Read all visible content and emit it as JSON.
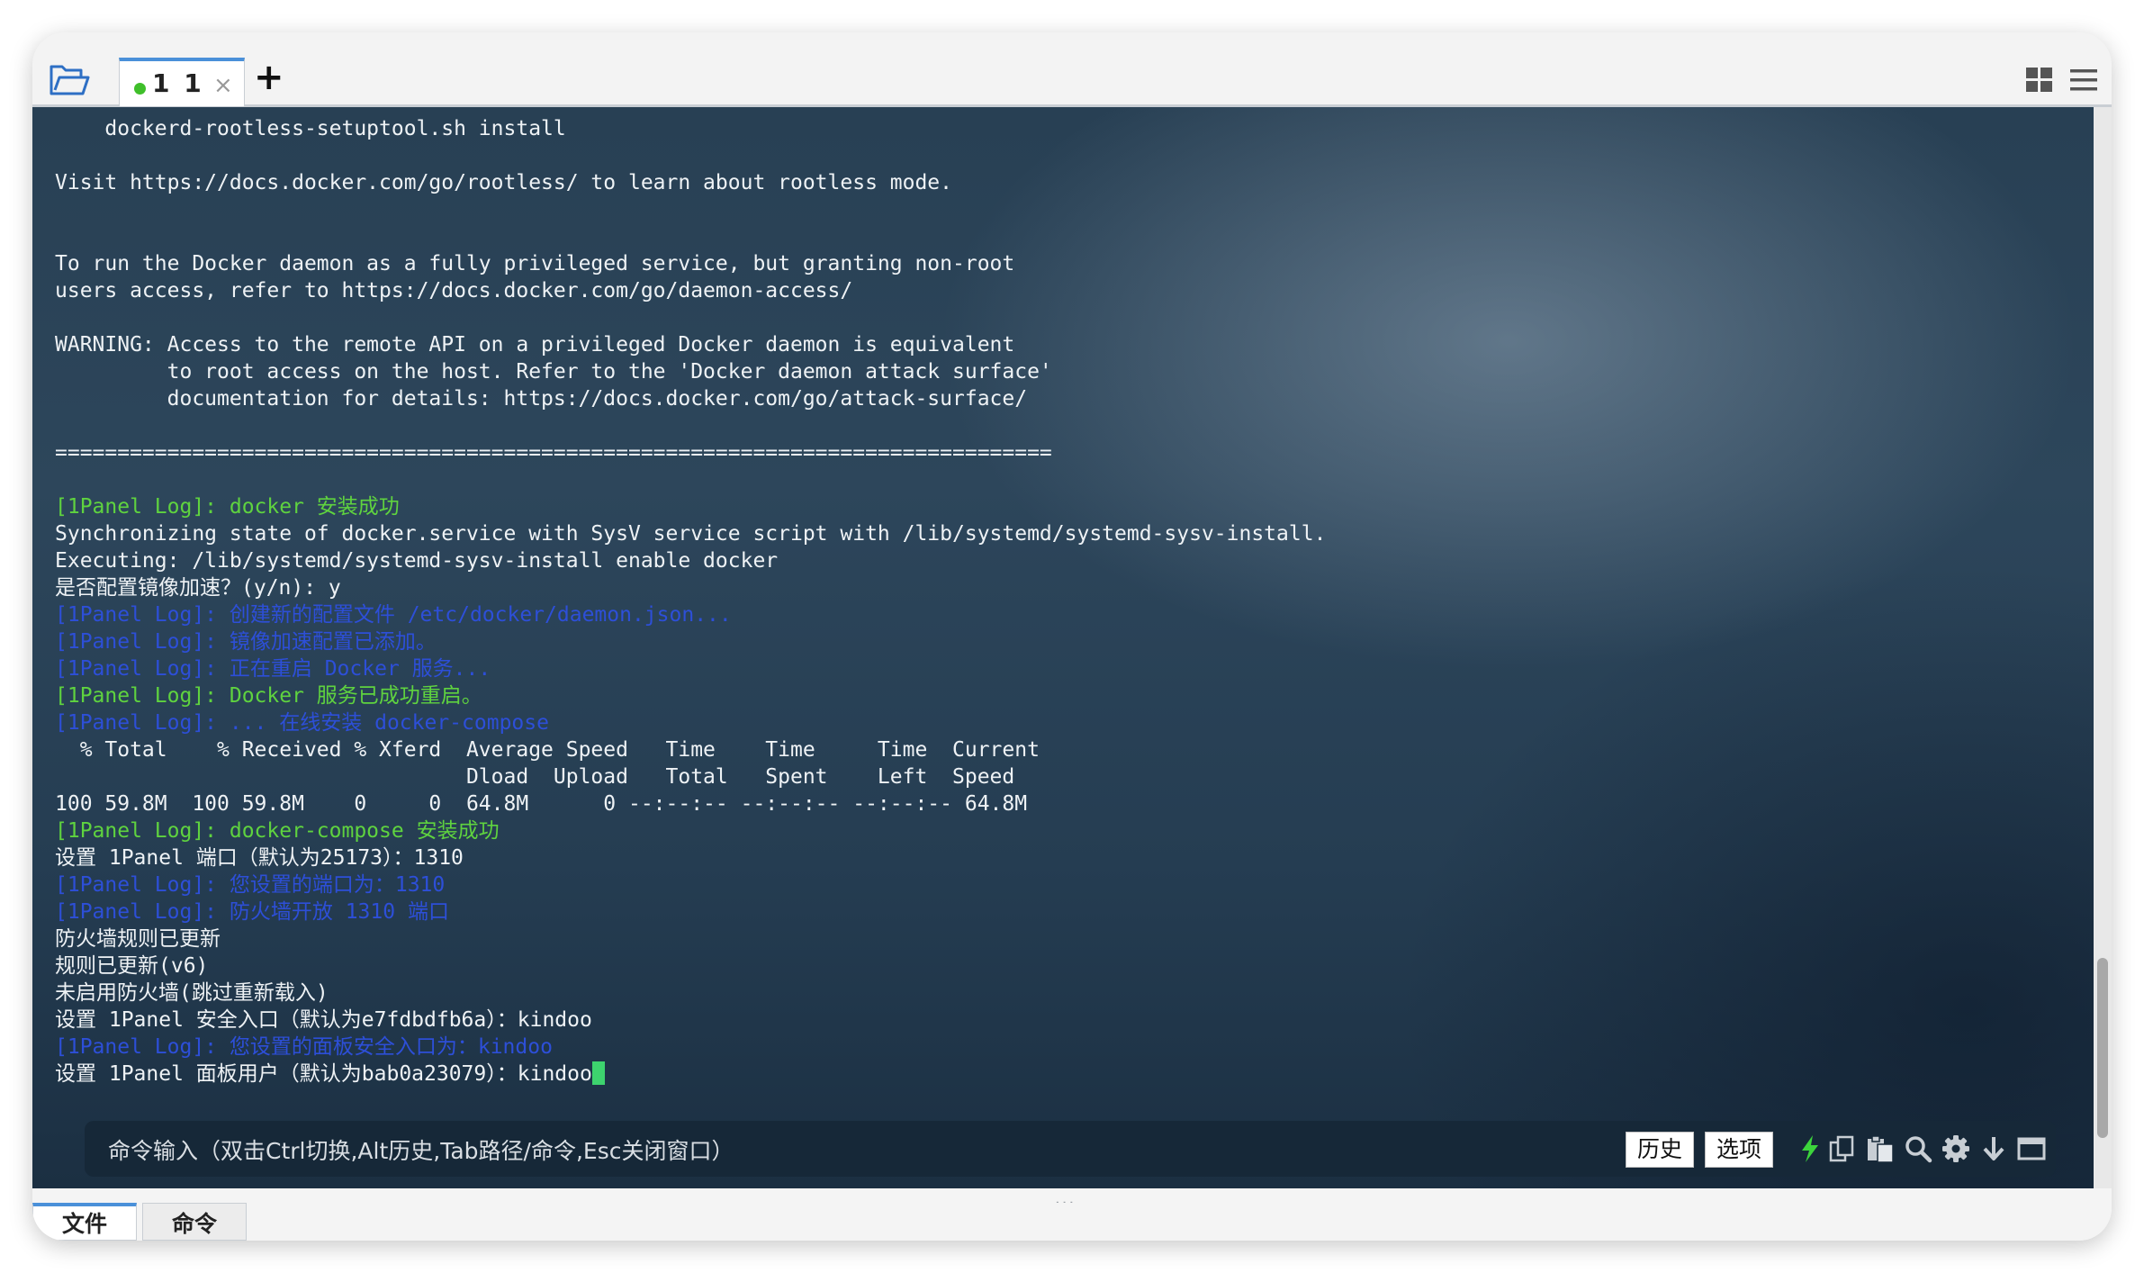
{
  "tabs": {
    "items": [
      {
        "label": "1 1",
        "status_color": "#3fbf2a"
      }
    ],
    "add_label": "+",
    "close_label": "×"
  },
  "terminal": {
    "lines": [
      {
        "text": "    dockerd-rootless-setuptool.sh install",
        "color": "white"
      },
      {
        "text": "",
        "color": "white"
      },
      {
        "text": "Visit https://docs.docker.com/go/rootless/ to learn about rootless mode.",
        "color": "white"
      },
      {
        "text": "",
        "color": "white"
      },
      {
        "text": "",
        "color": "white"
      },
      {
        "text": "To run the Docker daemon as a fully privileged service, but granting non-root",
        "color": "white"
      },
      {
        "text": "users access, refer to https://docs.docker.com/go/daemon-access/",
        "color": "white"
      },
      {
        "text": "",
        "color": "white"
      },
      {
        "text": "WARNING: Access to the remote API on a privileged Docker daemon is equivalent",
        "color": "white"
      },
      {
        "text": "         to root access on the host. Refer to the 'Docker daemon attack surface'",
        "color": "white"
      },
      {
        "text": "         documentation for details: https://docs.docker.com/go/attack-surface/",
        "color": "white"
      },
      {
        "text": "",
        "color": "white"
      },
      {
        "text": "================================================================================",
        "color": "white"
      },
      {
        "text": "",
        "color": "white"
      },
      {
        "text": "[1Panel Log]: docker 安装成功",
        "color": "green"
      },
      {
        "text": "Synchronizing state of docker.service with SysV service script with /lib/systemd/systemd-sysv-install.",
        "color": "white"
      },
      {
        "text": "Executing: /lib/systemd/systemd-sysv-install enable docker",
        "color": "white"
      },
      {
        "text": "是否配置镜像加速？(y/n): y",
        "color": "white"
      },
      {
        "text": "[1Panel Log]: 创建新的配置文件 /etc/docker/daemon.json...",
        "color": "blue"
      },
      {
        "text": "[1Panel Log]: 镜像加速配置已添加。",
        "color": "blue"
      },
      {
        "text": "[1Panel Log]: 正在重启 Docker 服务...",
        "color": "blue"
      },
      {
        "text": "[1Panel Log]: Docker 服务已成功重启。",
        "color": "green"
      },
      {
        "text": "[1Panel Log]: ... 在线安装 docker-compose",
        "color": "blue"
      },
      {
        "text": "  % Total    % Received % Xferd  Average Speed   Time    Time     Time  Current",
        "color": "white"
      },
      {
        "text": "                                 Dload  Upload   Total   Spent    Left  Speed",
        "color": "white"
      },
      {
        "text": "100 59.8M  100 59.8M    0     0  64.8M      0 --:--:-- --:--:-- --:--:-- 64.8M",
        "color": "white"
      },
      {
        "text": "[1Panel Log]: docker-compose 安装成功",
        "color": "green"
      },
      {
        "text": "设置 1Panel 端口（默认为25173）：1310",
        "color": "white"
      },
      {
        "text": "[1Panel Log]: 您设置的端口为：1310",
        "color": "blue"
      },
      {
        "text": "[1Panel Log]: 防火墙开放 1310 端口",
        "color": "blue"
      },
      {
        "text": "防火墙规则已更新",
        "color": "white"
      },
      {
        "text": "规则已更新(v6)",
        "color": "white"
      },
      {
        "text": "未启用防火墙(跳过重新载入)",
        "color": "white"
      },
      {
        "text": "设置 1Panel 安全入口（默认为e7fdbdfb6a）：kindoo",
        "color": "white"
      },
      {
        "text": "[1Panel Log]: 您设置的面板安全入口为：kindoo",
        "color": "blue"
      },
      {
        "text": "设置 1Panel 面板用户（默认为bab0a23079）：kindoo",
        "color": "white"
      }
    ],
    "colors": {
      "white": "#eef2f5",
      "green": "#5fd33f",
      "blue": "#2d4fd8",
      "cursor": "#3dd36e"
    }
  },
  "command_bar": {
    "placeholder": "命令输入（双击Ctrl切换,Alt历史,Tab路径/命令,Esc关闭窗口）",
    "history_label": "历史",
    "options_label": "选项",
    "tools": [
      "lightning-icon",
      "copy-icon",
      "paste-icon",
      "search-icon",
      "gear-icon",
      "download-icon",
      "window-icon"
    ]
  },
  "bottom_tabs": [
    {
      "label": "文件",
      "active": true
    },
    {
      "label": "命令",
      "active": false
    }
  ]
}
